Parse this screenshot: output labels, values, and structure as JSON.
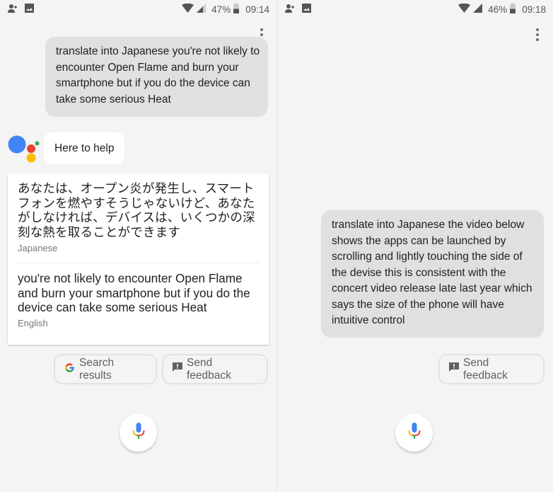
{
  "colors": {
    "google_blue": "#4285F4",
    "google_red": "#EA4335",
    "google_yellow": "#FBBC05",
    "google_green": "#34A853",
    "user_bubble": "#e0e0e0",
    "background": "#f4f4f4"
  },
  "screens": [
    {
      "status_bar": {
        "left_icons": [
          "add-contact-icon",
          "image-icon"
        ],
        "right_icons": [
          "wifi-icon",
          "cell-signal-icon",
          "battery-icon"
        ],
        "battery": "47%",
        "time": "09:14"
      },
      "menu_icon": "more-vert-icon",
      "user_message": "translate into Japanese you're not likely to encounter Open Flame and burn your smartphone but if you do the device can take some serious Heat",
      "assistant_message": "Here to help",
      "translation_card": {
        "translated_text": "あなたは、オープン炎が発生し、スマートフォンを燃やすそうじゃないけど、あなたがしなければ、デバイスは、いくつかの深刻な熱を取ることができます",
        "translated_language": "Japanese",
        "source_text": "you're not likely to encounter Open Flame and burn your smartphone but if you do the device can take some serious Heat",
        "source_language": "English"
      },
      "chips": [
        {
          "icon": "google-g-icon",
          "label": "Search results"
        },
        {
          "icon": "feedback-icon",
          "label": "Send feedback"
        }
      ],
      "mic_icon": "microphone-icon"
    },
    {
      "status_bar": {
        "left_icons": [
          "add-contact-icon",
          "image-icon"
        ],
        "right_icons": [
          "wifi-icon",
          "cell-signal-icon",
          "battery-icon"
        ],
        "battery": "46%",
        "time": "09:18"
      },
      "menu_icon": "more-vert-icon",
      "user_message": "translate into Japanese the video below shows the apps can be launched by scrolling and lightly touching the side of the devise this is consistent with the concert video release late last year which says the size of the phone will have intuitive control",
      "chips": [
        {
          "icon": "feedback-icon",
          "label": "Send feedback"
        }
      ],
      "mic_icon": "microphone-icon"
    }
  ]
}
